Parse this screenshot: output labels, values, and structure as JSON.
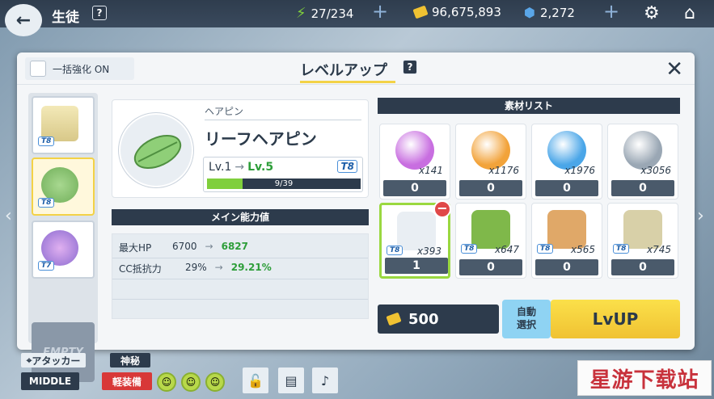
{
  "topbar": {
    "title": "生徒",
    "help": "?",
    "ap": "27/234",
    "credits": "96,675,893",
    "pyroxene": "2,272"
  },
  "panel": {
    "bulk_label": "一括強化 ON",
    "title": "レベルアップ",
    "help": "?",
    "close": "✕"
  },
  "equipment": {
    "slots": [
      {
        "tier": "T8"
      },
      {
        "tier": "T8"
      },
      {
        "tier": "T7"
      }
    ],
    "empty_label": "EMPTY"
  },
  "item": {
    "kind": "ヘアピン",
    "name": "リーフヘアピン",
    "lv_from": "Lv.1",
    "lv_to": "Lv.5",
    "tier": "T8",
    "xp_text": "9/39",
    "xp_fraction": 0.23
  },
  "stats": {
    "header": "メイン能力値",
    "rows": [
      {
        "name": "最大HP",
        "old": "6700",
        "new": "6827"
      },
      {
        "name": "CC抵抗力",
        "old": "29%",
        "new": "29.21%"
      }
    ]
  },
  "materials": {
    "header": "素材リスト",
    "items": [
      {
        "count": "x141",
        "use": "0",
        "color": "#c86ee0"
      },
      {
        "count": "x1176",
        "use": "0",
        "color": "#f2a33a"
      },
      {
        "count": "x1976",
        "use": "0",
        "color": "#4aa6e8"
      },
      {
        "count": "x3056",
        "use": "0",
        "color": "#9aa7b4"
      },
      {
        "count": "x393",
        "use": "1",
        "tier": "T8",
        "color": "#e9eef3"
      },
      {
        "count": "x647",
        "use": "0",
        "tier": "T8",
        "color": "#7fb84a"
      },
      {
        "count": "x565",
        "use": "0",
        "tier": "T8",
        "color": "#e0a868"
      },
      {
        "count": "x745",
        "use": "0",
        "tier": "T8",
        "color": "#d8d0a8"
      }
    ]
  },
  "actions": {
    "cost": "500",
    "auto_line1": "自動",
    "auto_line2": "選択",
    "lvup": "LvUP"
  },
  "bottom": {
    "role": "アタッカー",
    "position": "MIDDLE",
    "type1": "神秘",
    "type2": "軽装備"
  },
  "watermark": "星游下载站"
}
